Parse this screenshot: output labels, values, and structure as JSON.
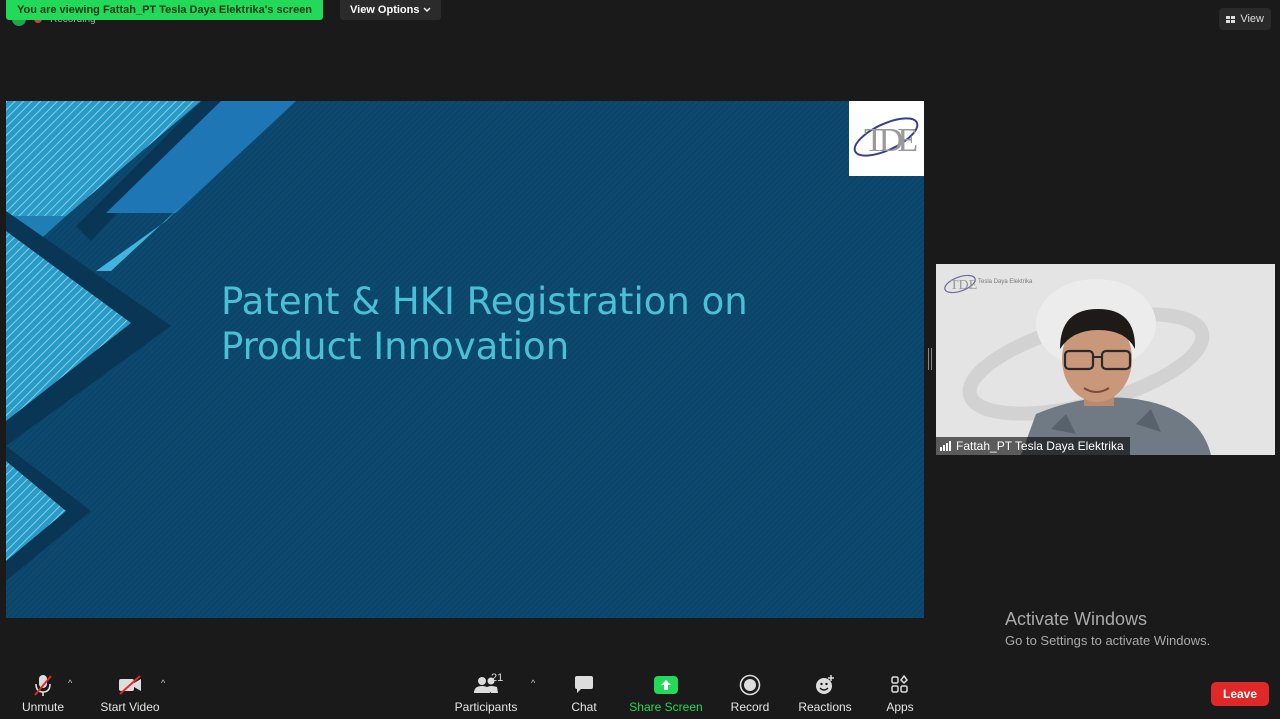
{
  "top_bar": {
    "sharing_banner": "You are viewing Fattah_PT Tesla Daya Elektrika's screen",
    "view_options_label": "View Options",
    "recording_label": "Recording",
    "view_button_label": "View"
  },
  "slide": {
    "title_line1": "Patent & HKI Registration on",
    "title_line2": "Product Innovation",
    "logo_text": "TDE"
  },
  "participant_video": {
    "name": "Fattah_PT Tesla Daya Elektrika",
    "background_brand": "Tesla Daya Elektrika"
  },
  "watermark": {
    "title": "Activate Windows",
    "subtitle": "Go to Settings to activate Windows."
  },
  "toolbar": {
    "unmute_label": "Unmute",
    "start_video_label": "Start Video",
    "participants_label": "Participants",
    "participants_count": "21",
    "chat_label": "Chat",
    "share_screen_label": "Share Screen",
    "record_label": "Record",
    "reactions_label": "Reactions",
    "apps_label": "Apps",
    "leave_label": "Leave"
  },
  "colors": {
    "banner_green": "#23d959",
    "leave_red": "#e02828",
    "slide_title": "#4ac0d6",
    "slide_background": "#0d4a70"
  },
  "icons": [
    "shield-icon",
    "recording-dot-icon",
    "chevron-down-icon",
    "view-grid-icon",
    "signal-icon",
    "microphone-muted-icon",
    "video-camera-muted-icon",
    "participants-icon",
    "chat-bubble-icon",
    "share-screen-icon",
    "record-icon",
    "reactions-icon",
    "apps-icon"
  ]
}
